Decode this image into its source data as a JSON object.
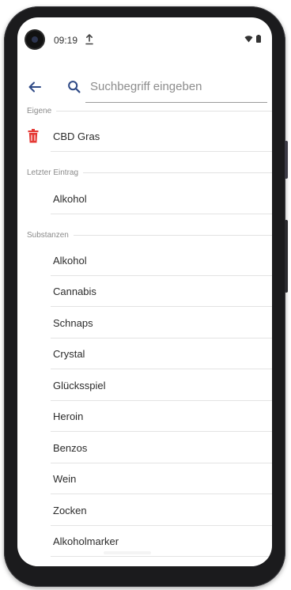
{
  "status_bar": {
    "time": "09:19",
    "upload_icon": "upload-icon",
    "wifi_icon": "wifi-icon",
    "battery_icon": "battery-icon"
  },
  "search": {
    "back_icon": "arrow-back-icon",
    "search_icon": "search-icon",
    "placeholder": "Suchbegriff eingeben",
    "value": ""
  },
  "colors": {
    "accent": "#2f4a86",
    "delete": "#e53935",
    "divider": "#e3e3e3",
    "section_text": "#8a8a8a"
  },
  "sections": {
    "own": {
      "title": "Eigene",
      "items": [
        {
          "label": "CBD Gras",
          "icon": "trash-icon"
        }
      ]
    },
    "last": {
      "title": "Letzter Eintrag",
      "items": [
        {
          "label": "Alkohol"
        }
      ]
    },
    "substances": {
      "title": "Substanzen",
      "items": [
        {
          "label": "Alkohol"
        },
        {
          "label": "Cannabis"
        },
        {
          "label": "Schnaps"
        },
        {
          "label": "Crystal"
        },
        {
          "label": "Glücksspiel"
        },
        {
          "label": "Heroin"
        },
        {
          "label": "Benzos"
        },
        {
          "label": "Wein"
        },
        {
          "label": "Zocken"
        },
        {
          "label": "Alkoholmarker"
        }
      ]
    }
  }
}
